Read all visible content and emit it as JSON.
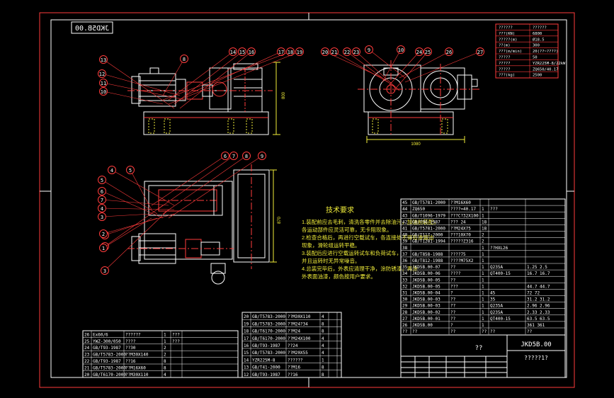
{
  "drawing_code": "JKD5B.00",
  "drawing_code_mirrored": "JKD5B.00",
  "params": [
    [
      "??????",
      "??????"
    ],
    [
      "???(KN)",
      "6800"
    ],
    [
      "?????(m)",
      "Ø18.5"
    ],
    [
      "??(m)",
      "300"
    ],
    [
      "???(m/min)",
      "20(??~????)"
    ],
    [
      "?????",
      "50"
    ],
    [
      "?????",
      "YZR225M-8/22kW"
    ],
    [
      "?????",
      "ZQ650/40.17"
    ],
    [
      "???(kg)",
      "2500"
    ]
  ],
  "front_view_balloons": [
    "8",
    "14",
    "15",
    "16",
    "17",
    "18",
    "19",
    "13",
    "12",
    "11",
    "10"
  ],
  "side_view_balloons": [
    "20",
    "21",
    "22",
    "23",
    "9",
    "10",
    "24",
    "25",
    "26",
    "27"
  ],
  "plan_view_balloons": [
    "6",
    "7",
    "8",
    "9",
    "4",
    "5",
    "5",
    "6",
    "7",
    "4",
    "3",
    "2",
    "1",
    "3",
    "2",
    "1"
  ],
  "dims": {
    "front_height": "800",
    "side_width": "1080",
    "plan_width": "870"
  },
  "notes_title": "技术要求",
  "notes": [
    "1.装配前应去毛刺，清洗各零件并去除油污，加油前装配，",
    "  各运动部件应灵活可靠，无卡阻现象。",
    "2.检查合格后，再进行空载试车，各连接处不得有渗漏油",
    "  现象，滑轮组运转平稳。",
    "3.装配后应进行空载运转试车和负荷试车，",
    "  并且运转时无异常噪音。",
    "4.总装完毕后，外表应清理干净，涂防锈漆，再涂",
    "  外表面油漆，颜色按用户要求。"
  ],
  "right_bom": [
    [
      "45",
      "GB/T5781-2000",
      "??M16X60",
      "",
      "",
      ""
    ],
    [
      "44",
      "ZQ650",
      "????=40.17",
      "1",
      "???",
      ""
    ],
    [
      "43",
      "GB/T1096-1979",
      "???C?32X100",
      "1",
      "",
      ""
    ],
    [
      "42",
      "GB/T96-1987",
      "??? 24",
      "18",
      "",
      ""
    ],
    [
      "41",
      "GB/T5781-2000",
      "??M24X75",
      "18",
      "",
      ""
    ],
    [
      "40",
      "GB/T117-2000",
      "???10X70",
      "2",
      "",
      ""
    ],
    [
      "39",
      "GB/T1281-1994",
      "?????Z316",
      "2",
      "",
      ""
    ],
    [
      "38",
      "",
      "",
      "1",
      "??HXL26",
      ""
    ],
    [
      "37",
      "GB/T858-1988",
      "????75",
      "1",
      "",
      ""
    ],
    [
      "36",
      "GB/T812-1988",
      "????M75X2",
      "1",
      "",
      ""
    ],
    [
      "35",
      "JKD5B.00-07",
      "??",
      "1",
      "Q235A",
      "1.25 2.5"
    ],
    [
      "34",
      "JKD5B.00-06",
      "????",
      "1",
      "QT400-15",
      "16.7 16.7"
    ],
    [
      "33",
      "JKD5B.00-05",
      "??",
      "1",
      "",
      ""
    ],
    [
      "32",
      "JKD5B.00-05",
      "???",
      "1",
      "",
      "44.7 44.7"
    ],
    [
      "31",
      "JKD5B.00-04",
      "?",
      "1",
      "45",
      "72 72"
    ],
    [
      "30",
      "JKD5B.00-03",
      "??",
      "1",
      "35",
      "31.2 31.2"
    ],
    [
      "29",
      "JKD5B.00-03",
      "??",
      "1",
      "Q235A",
      "2.96 2.96"
    ],
    [
      "28",
      "JKD5B.00-02",
      "??",
      "1",
      "Q235A",
      "2.33 2.33"
    ],
    [
      "27",
      "JKD5B.00-01",
      "??",
      "1",
      "QT400-15",
      "63.5 63.5"
    ],
    [
      "26",
      "JKD5B.00",
      "?",
      "1",
      "",
      "361 361"
    ],
    [
      "??",
      "??",
      "??",
      "??",
      "??",
      "??"
    ]
  ],
  "left_bom": [
    [
      "26",
      "Ex60/6",
      "??????",
      "1",
      "???",
      ""
    ],
    [
      "25",
      "YWZ-300/050",
      "????",
      "1",
      "???",
      ""
    ],
    [
      "24",
      "GB/T93-1987",
      "??30",
      "2",
      "",
      ""
    ],
    [
      "23",
      "GB/T5783-2000",
      "??M30X140",
      "2",
      "",
      ""
    ],
    [
      "22",
      "GB/T93-1987",
      "??16",
      "8",
      "",
      ""
    ],
    [
      "21",
      "GB/T5783-2000",
      "??M16X60",
      "8",
      "",
      ""
    ],
    [
      "20",
      "GB/T6170-2000",
      "??M30X110",
      "4",
      "",
      ""
    ]
  ],
  "mid_bom": [
    [
      "20",
      "GB/T5783-2000",
      "??M30X110",
      "4",
      "",
      ""
    ],
    [
      "19",
      "GB/T5783-2000",
      "??M24?34",
      "8",
      "",
      ""
    ],
    [
      "18",
      "GB/T6170-2000",
      "??M24",
      "8",
      "",
      ""
    ],
    [
      "17",
      "GB/T6170-2000",
      "??M24X100",
      "4",
      "",
      ""
    ],
    [
      "16",
      "GB/T93-1987",
      "??24",
      "4",
      "",
      ""
    ],
    [
      "15",
      "GB/T5783-2000",
      "??M20X55",
      "4",
      "",
      ""
    ],
    [
      "14",
      "YZR225M-8",
      "??????",
      "1",
      "",
      ""
    ],
    [
      "13",
      "GB/T41-2000",
      "??M16",
      "8",
      "",
      ""
    ],
    [
      "12",
      "GB/T93-1987",
      "??16",
      "8",
      "",
      ""
    ]
  ],
  "title_block": {
    "name": "??",
    "code": "JKD5B.00",
    "company": "?????1?",
    "scale": "??"
  }
}
